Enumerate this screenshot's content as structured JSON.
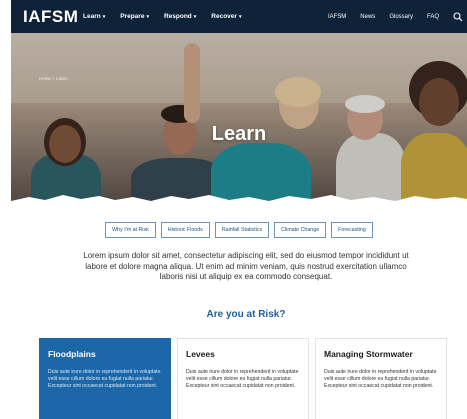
{
  "header": {
    "logo": "IAFSM",
    "nav": [
      {
        "label": "Learn",
        "caret": "▾"
      },
      {
        "label": "Prepare",
        "caret": "▾"
      },
      {
        "label": "Respond",
        "caret": "▾"
      },
      {
        "label": "Recover",
        "caret": "▾"
      }
    ],
    "util": [
      "IAFSM",
      "News",
      "Glossary",
      "FAQ"
    ],
    "search_icon": "search-icon"
  },
  "hero": {
    "breadcrumb": [
      "Home",
      "/",
      "Learn"
    ],
    "title": "Learn"
  },
  "topics": [
    "Why I'm at Risk",
    "Historic Floods",
    "Rainfall Statistics",
    "Climate Change",
    "Forecasting"
  ],
  "intro": "Lorem ipsum dolor sit amet, consectetur adipiscing elit, sed do eiusmod tempor incididunt ut labore et dolore magna aliqua. Ut enim ad minim veniam, quis nostrud exercitation ullamco laboris nisi ut aliquip ex ea commodo consequat.",
  "risk_heading": "Are you at Risk?",
  "cards": [
    {
      "title": "Floodplains",
      "text": "Duis aute irure dolor in reprehenderit in voluptate velit esse cillum dolore eu fugiat nulla pariatur. Excepteur sint occaecat cupidatat non proident."
    },
    {
      "title": "Levees",
      "text": "Duis aute irure dolor in reprehenderit in voluptate velit esse cillum dolore eu fugiat nulla pariatur. Excepteur sint occaecat cupidatat non proident."
    },
    {
      "title": "Managing Stormwater",
      "text": "Duis aute irure dolor in reprehenderit in voluptate velit esse cillum dolore eu fugiat nulla pariatur. Excepteur sint occaecat cupidatat non proident."
    }
  ],
  "colors": {
    "nav_bg": "#0e2238",
    "accent": "#1c67a8",
    "heading": "#1f5e9a",
    "topic_border": "#6f92b6"
  }
}
